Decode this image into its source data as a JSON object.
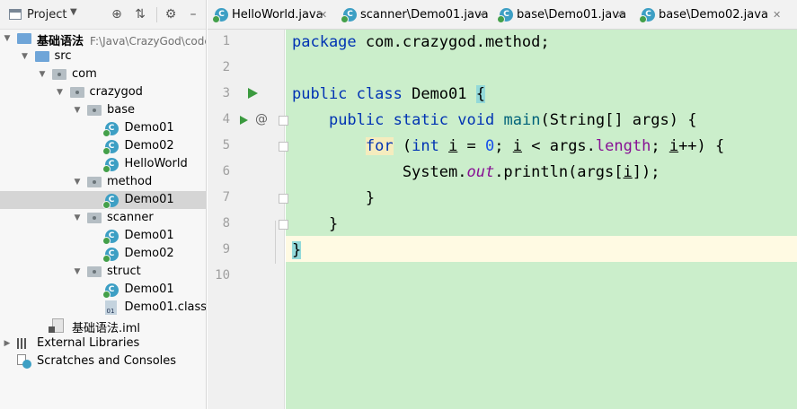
{
  "project_panel": {
    "title": "Project",
    "tools": [
      "target-icon",
      "collapse-icon",
      "gear-icon",
      "minimize-icon"
    ],
    "tree": [
      {
        "label": "基础语法",
        "path": "F:\\Java\\CrazyGod\\code",
        "indent": 0,
        "icon": "module-folder",
        "arrow": "down",
        "bold": true
      },
      {
        "label": "src",
        "indent": 1,
        "icon": "source-folder",
        "arrow": "down"
      },
      {
        "label": "com",
        "indent": 2,
        "icon": "package",
        "arrow": "down"
      },
      {
        "label": "crazygod",
        "indent": 3,
        "icon": "package",
        "arrow": "down"
      },
      {
        "label": "base",
        "indent": 4,
        "icon": "package",
        "arrow": "down"
      },
      {
        "label": "Demo01",
        "indent": 5,
        "icon": "java-class"
      },
      {
        "label": "Demo02",
        "indent": 5,
        "icon": "java-class"
      },
      {
        "label": "HelloWorld",
        "indent": 5,
        "icon": "java-class"
      },
      {
        "label": "method",
        "indent": 4,
        "icon": "package",
        "arrow": "down"
      },
      {
        "label": "Demo01",
        "indent": 5,
        "icon": "java-class",
        "selected": true
      },
      {
        "label": "scanner",
        "indent": 4,
        "icon": "package",
        "arrow": "down"
      },
      {
        "label": "Demo01",
        "indent": 5,
        "icon": "java-class"
      },
      {
        "label": "Demo02",
        "indent": 5,
        "icon": "java-class"
      },
      {
        "label": "struct",
        "indent": 4,
        "icon": "package",
        "arrow": "down"
      },
      {
        "label": "Demo01",
        "indent": 5,
        "icon": "java-class"
      },
      {
        "label": "Demo01.class",
        "indent": 5,
        "icon": "class-file"
      },
      {
        "label": "基础语法.iml",
        "indent": 2,
        "icon": "iml-file"
      },
      {
        "label": "External Libraries",
        "indent": 0,
        "icon": "libraries",
        "arrow": "right"
      },
      {
        "label": "Scratches and Consoles",
        "indent": 0,
        "icon": "scratches"
      }
    ]
  },
  "tabs": [
    {
      "label": "HelloWorld.java"
    },
    {
      "label": "scanner\\Demo01.java"
    },
    {
      "label": "base\\Demo01.java"
    },
    {
      "label": "base\\Demo02.java"
    }
  ],
  "editor": {
    "line_numbers": [
      "1",
      "2",
      "3",
      "4",
      "5",
      "6",
      "7",
      "8",
      "9",
      "10"
    ],
    "current_line": 9,
    "lines": [
      {
        "segs": [
          {
            "t": "package",
            "c": "kw"
          },
          {
            "t": " com.crazygod.method;"
          }
        ]
      },
      {
        "segs": []
      },
      {
        "segs": [
          {
            "t": "public",
            "c": "kw"
          },
          {
            "t": " "
          },
          {
            "t": "class",
            "c": "kw"
          },
          {
            "t": " Demo01 "
          },
          {
            "t": "{",
            "c": "brace-hl"
          }
        ]
      },
      {
        "segs": [
          {
            "t": "    "
          },
          {
            "t": "public",
            "c": "kw"
          },
          {
            "t": " "
          },
          {
            "t": "static",
            "c": "kw"
          },
          {
            "t": " "
          },
          {
            "t": "void",
            "c": "kw"
          },
          {
            "t": " "
          },
          {
            "t": "main",
            "c": "fn"
          },
          {
            "t": "(String[] args) {"
          }
        ]
      },
      {
        "segs": [
          {
            "t": "        "
          },
          {
            "t": "for",
            "c": "kw for-hl"
          },
          {
            "t": " ("
          },
          {
            "t": "int",
            "c": "kw"
          },
          {
            "t": " "
          },
          {
            "t": "i",
            "c": "ul"
          },
          {
            "t": " = "
          },
          {
            "t": "0",
            "c": "num"
          },
          {
            "t": "; "
          },
          {
            "t": "i",
            "c": "ul"
          },
          {
            "t": " < args."
          },
          {
            "t": "length",
            "c": "fld"
          },
          {
            "t": "; "
          },
          {
            "t": "i",
            "c": "ul"
          },
          {
            "t": "++) {"
          }
        ]
      },
      {
        "segs": [
          {
            "t": "            System."
          },
          {
            "t": "out",
            "c": "sfld"
          },
          {
            "t": ".println(args["
          },
          {
            "t": "i",
            "c": "ul"
          },
          {
            "t": "]);"
          }
        ]
      },
      {
        "segs": [
          {
            "t": "        }"
          }
        ]
      },
      {
        "segs": [
          {
            "t": "    }"
          }
        ]
      },
      {
        "segs": [
          {
            "t": "}",
            "c": "brace-hl"
          }
        ]
      },
      {
        "segs": []
      }
    ]
  },
  "colors": {
    "editor_background": "#cbeecb",
    "keyword": "#0033b3",
    "number": "#1750eb",
    "field": "#871094",
    "method": "#00627a",
    "brace_highlight": "#93d9d9",
    "current_line": "#fffae3"
  }
}
